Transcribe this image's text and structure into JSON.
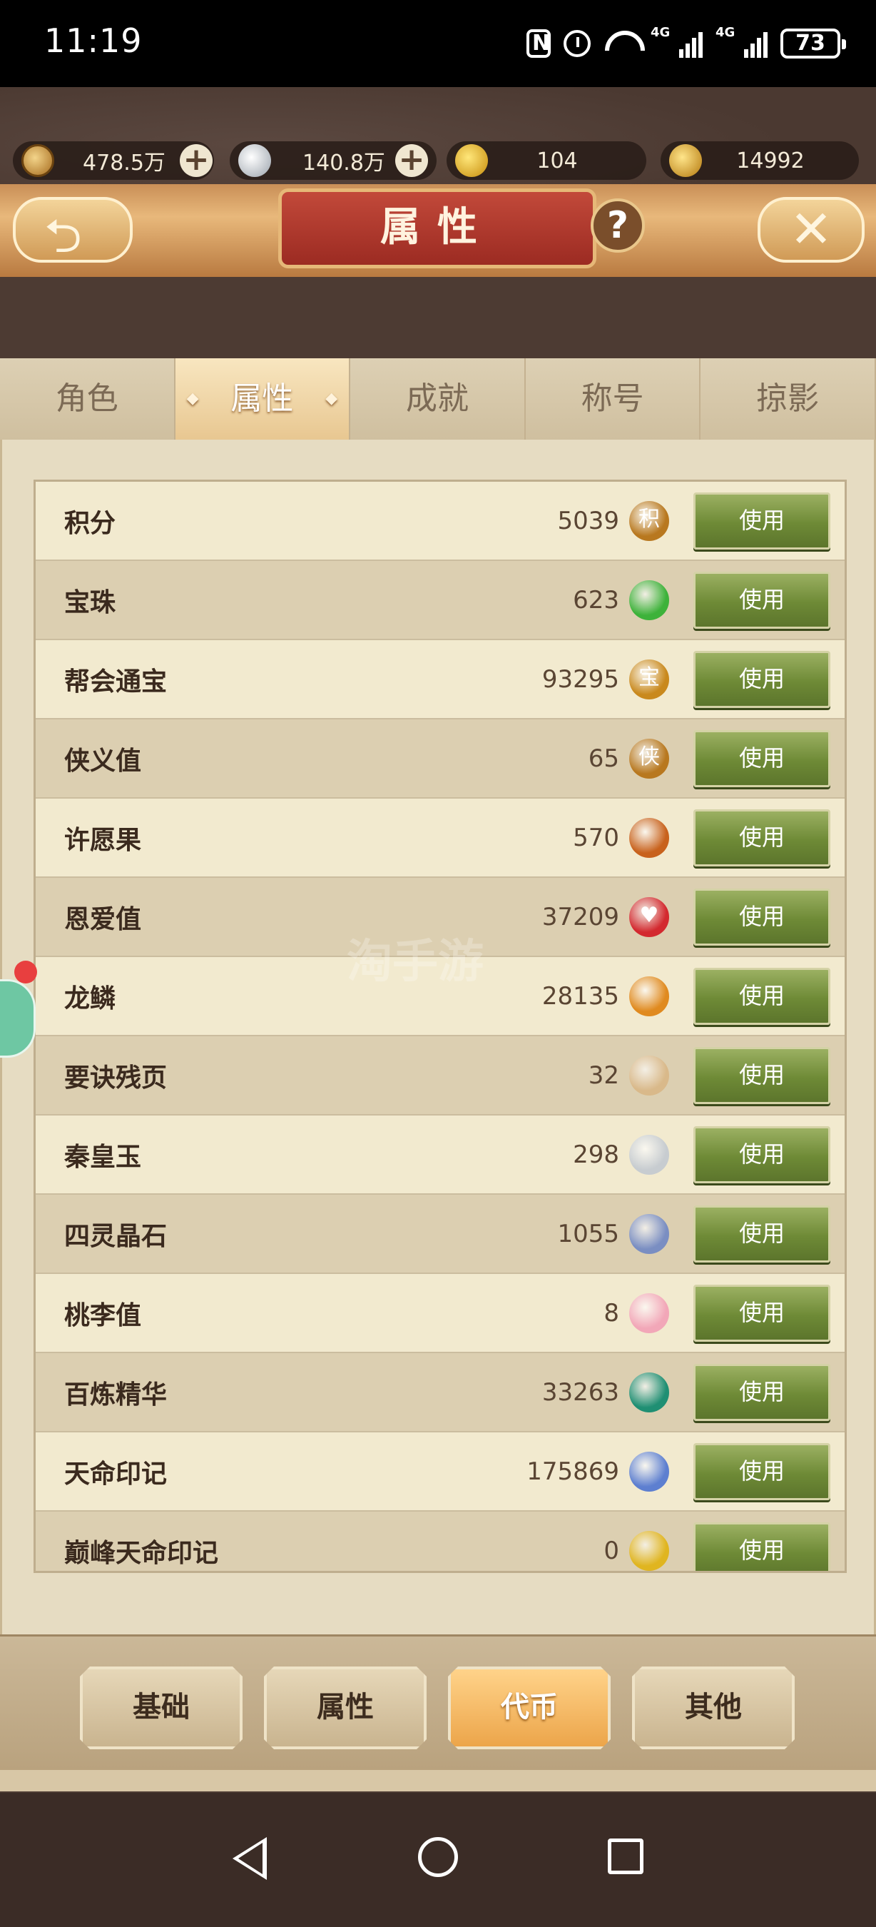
{
  "status_bar": {
    "time": "11:19",
    "signal_label_1": "4G",
    "signal_label_2": "4G",
    "battery": "73"
  },
  "currencies": [
    {
      "icon": "copper-coin-icon",
      "value": "478.5万"
    },
    {
      "icon": "silver-ingot-icon",
      "value": "140.8万"
    },
    {
      "icon": "gold-ingot-icon",
      "value": "104"
    },
    {
      "icon": "bound-gold-ingot-icon",
      "value": "14992"
    }
  ],
  "header": {
    "title": "属性",
    "help": "?",
    "close": "✕"
  },
  "tabs": [
    {
      "label": "角色",
      "active": false
    },
    {
      "label": "属性",
      "active": true
    },
    {
      "label": "成就",
      "active": false
    },
    {
      "label": "称号",
      "active": false
    },
    {
      "label": "掠影",
      "active": false
    }
  ],
  "items": [
    {
      "name": "积分",
      "value": "5039",
      "icon": "points-icon",
      "icon_text": "积",
      "color": "#b8781f"
    },
    {
      "name": "宝珠",
      "value": "623",
      "icon": "green-orb-icon",
      "icon_text": "",
      "color": "#3db23a"
    },
    {
      "name": "帮会通宝",
      "value": "93295",
      "icon": "guild-coin-icon",
      "icon_text": "宝",
      "color": "#c9891d"
    },
    {
      "name": "侠义值",
      "value": "65",
      "icon": "chivalry-icon",
      "icon_text": "侠",
      "color": "#b8781f"
    },
    {
      "name": "许愿果",
      "value": "570",
      "icon": "wish-fruit-icon",
      "icon_text": "",
      "color": "#c8621d"
    },
    {
      "name": "恩爱值",
      "value": "37209",
      "icon": "heart-icon",
      "icon_text": "♥",
      "color": "#d3292f"
    },
    {
      "name": "龙鳞",
      "value": "28135",
      "icon": "dragon-scale-icon",
      "icon_text": "",
      "color": "#e08a1f"
    },
    {
      "name": "要诀残页",
      "value": "32",
      "icon": "scroll-page-icon",
      "icon_text": "",
      "color": "#d9b98a"
    },
    {
      "name": "秦皇玉",
      "value": "298",
      "icon": "jade-icon",
      "icon_text": "",
      "color": "#c7ccd0"
    },
    {
      "name": "四灵晶石",
      "value": "1055",
      "icon": "crystal-icon",
      "icon_text": "",
      "color": "#7a8ec2"
    },
    {
      "name": "桃李值",
      "value": "8",
      "icon": "peach-blossom-icon",
      "icon_text": "",
      "color": "#f2a7b8"
    },
    {
      "name": "百炼精华",
      "value": "33263",
      "icon": "emerald-icon",
      "icon_text": "",
      "color": "#1f8f73"
    },
    {
      "name": "天命印记",
      "value": "175869",
      "icon": "destiny-mark-icon",
      "icon_text": "",
      "color": "#5d7fd0"
    },
    {
      "name": "巅峰天命印记",
      "value": "0",
      "icon": "peak-destiny-mark-icon",
      "icon_text": "",
      "color": "#e0b520"
    }
  ],
  "use_label": "使用",
  "categories": [
    {
      "label": "基础",
      "active": false
    },
    {
      "label": "属性",
      "active": false
    },
    {
      "label": "代币",
      "active": true
    },
    {
      "label": "其他",
      "active": false
    }
  ],
  "watermark": "淘手游"
}
